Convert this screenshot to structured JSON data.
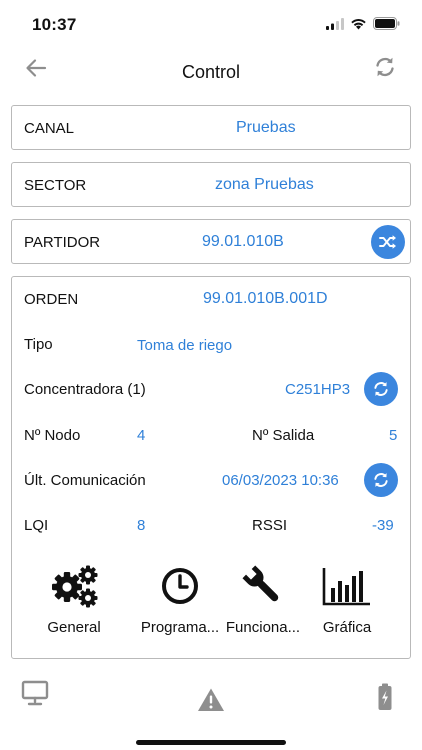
{
  "status_bar": {
    "time": "10:37",
    "icons": [
      "signal-icon",
      "wifi-icon",
      "battery-icon"
    ]
  },
  "nav": {
    "title": "Control",
    "back_icon": "arrow-left-icon",
    "refresh_icon": "sync-icon"
  },
  "rows": {
    "canal": {
      "label": "CANAL",
      "value": "Pruebas"
    },
    "sector": {
      "label": "SECTOR",
      "value": "zona Pruebas"
    },
    "partidor": {
      "label": "PARTIDOR",
      "value": "99.01.010B",
      "action_icon": "shuffle-icon"
    }
  },
  "detail": {
    "orden": {
      "label": "ORDEN",
      "value": "99.01.010B.001D"
    },
    "tipo": {
      "label": "Tipo",
      "value": "Toma de riego"
    },
    "concentradora": {
      "label": "Concentradora (1)",
      "value": "C251HP3",
      "action_icon": "sync-icon"
    },
    "nodo": {
      "label": "Nº Nodo",
      "value": "4"
    },
    "salida": {
      "label": "Nº Salida",
      "value": "5"
    },
    "comunicacion": {
      "label": "Últ. Comunicación",
      "value": "06/03/2023 10:36",
      "action_icon": "sync-icon"
    },
    "lqi": {
      "label": "LQI",
      "value": "8"
    },
    "rssi": {
      "label": "RSSI",
      "value": "-39"
    },
    "tools": [
      {
        "label": "General",
        "icon": "gears-icon"
      },
      {
        "label": "Programa...",
        "icon": "clock-icon"
      },
      {
        "label": "Funciona...",
        "icon": "wrench-icon"
      },
      {
        "label": "Gráfica",
        "icon": "bar-chart-icon"
      }
    ]
  },
  "tabs": [
    {
      "icon": "monitor-icon"
    },
    {
      "icon": "warning-icon"
    },
    {
      "icon": "battery-vertical-icon"
    }
  ],
  "colors": {
    "accent": "#2f80d8",
    "button": "#3b86de",
    "border": "#b9b9b9",
    "icon_gray": "#8e8e8e"
  }
}
